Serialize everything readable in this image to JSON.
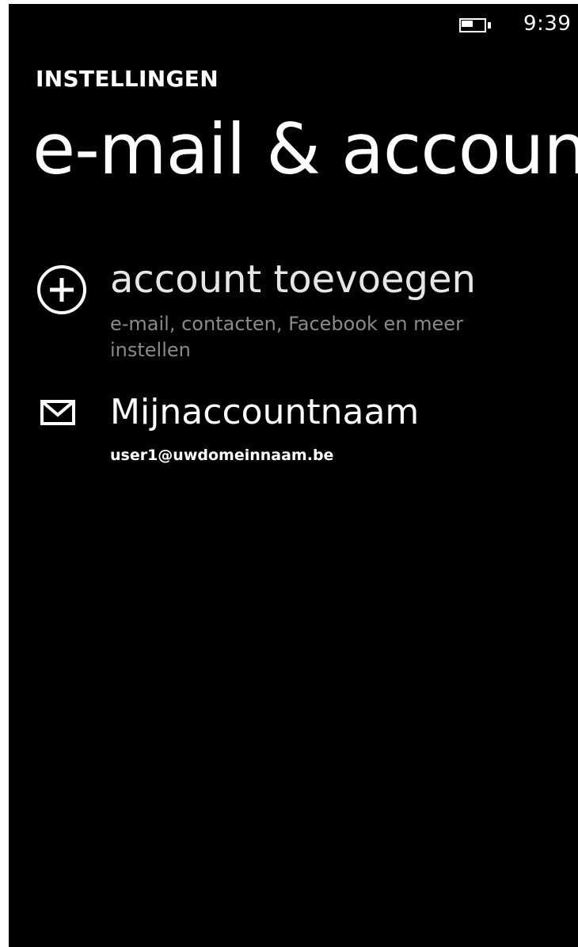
{
  "status_bar": {
    "time": "9:39",
    "battery_icon": "battery-icon",
    "battery_level": 0.6
  },
  "header": {
    "section": "INSTELLINGEN",
    "title": "e-mail & accounts"
  },
  "list": {
    "add_account": {
      "icon": "plus-circle-icon",
      "title": "account toevoegen",
      "subtitle": "e-mail, contacten, Facebook en meer instellen"
    },
    "accounts": [
      {
        "icon": "mail-icon",
        "name": "Mijnaccountnaam",
        "email": "user1@uwdomeinnaam.be"
      }
    ]
  },
  "colors": {
    "background": "#000000",
    "foreground": "#ffffff",
    "secondary_text": "#8a8a8a"
  }
}
